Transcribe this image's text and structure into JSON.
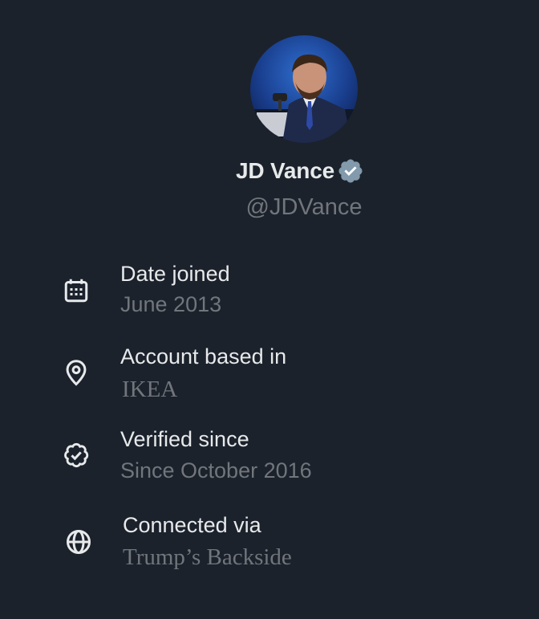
{
  "profile": {
    "name": "JD Vance",
    "handle": "@JDVance",
    "verified_badge_color": "#829aab"
  },
  "about": {
    "items": [
      {
        "icon": "calendar-icon",
        "label": "Date joined",
        "value": "June 2013"
      },
      {
        "icon": "location-pin-icon",
        "label": "Account based in",
        "value": "IKEA"
      },
      {
        "icon": "verified-badge-icon",
        "label": "Verified since",
        "value": "Since October 2016"
      },
      {
        "icon": "globe-icon",
        "label": "Connected via",
        "value": "Trump’s Backside"
      }
    ]
  },
  "colors": {
    "background": "#1b222c",
    "primary_text": "#e7e9ea",
    "secondary_text": "#71767b"
  }
}
